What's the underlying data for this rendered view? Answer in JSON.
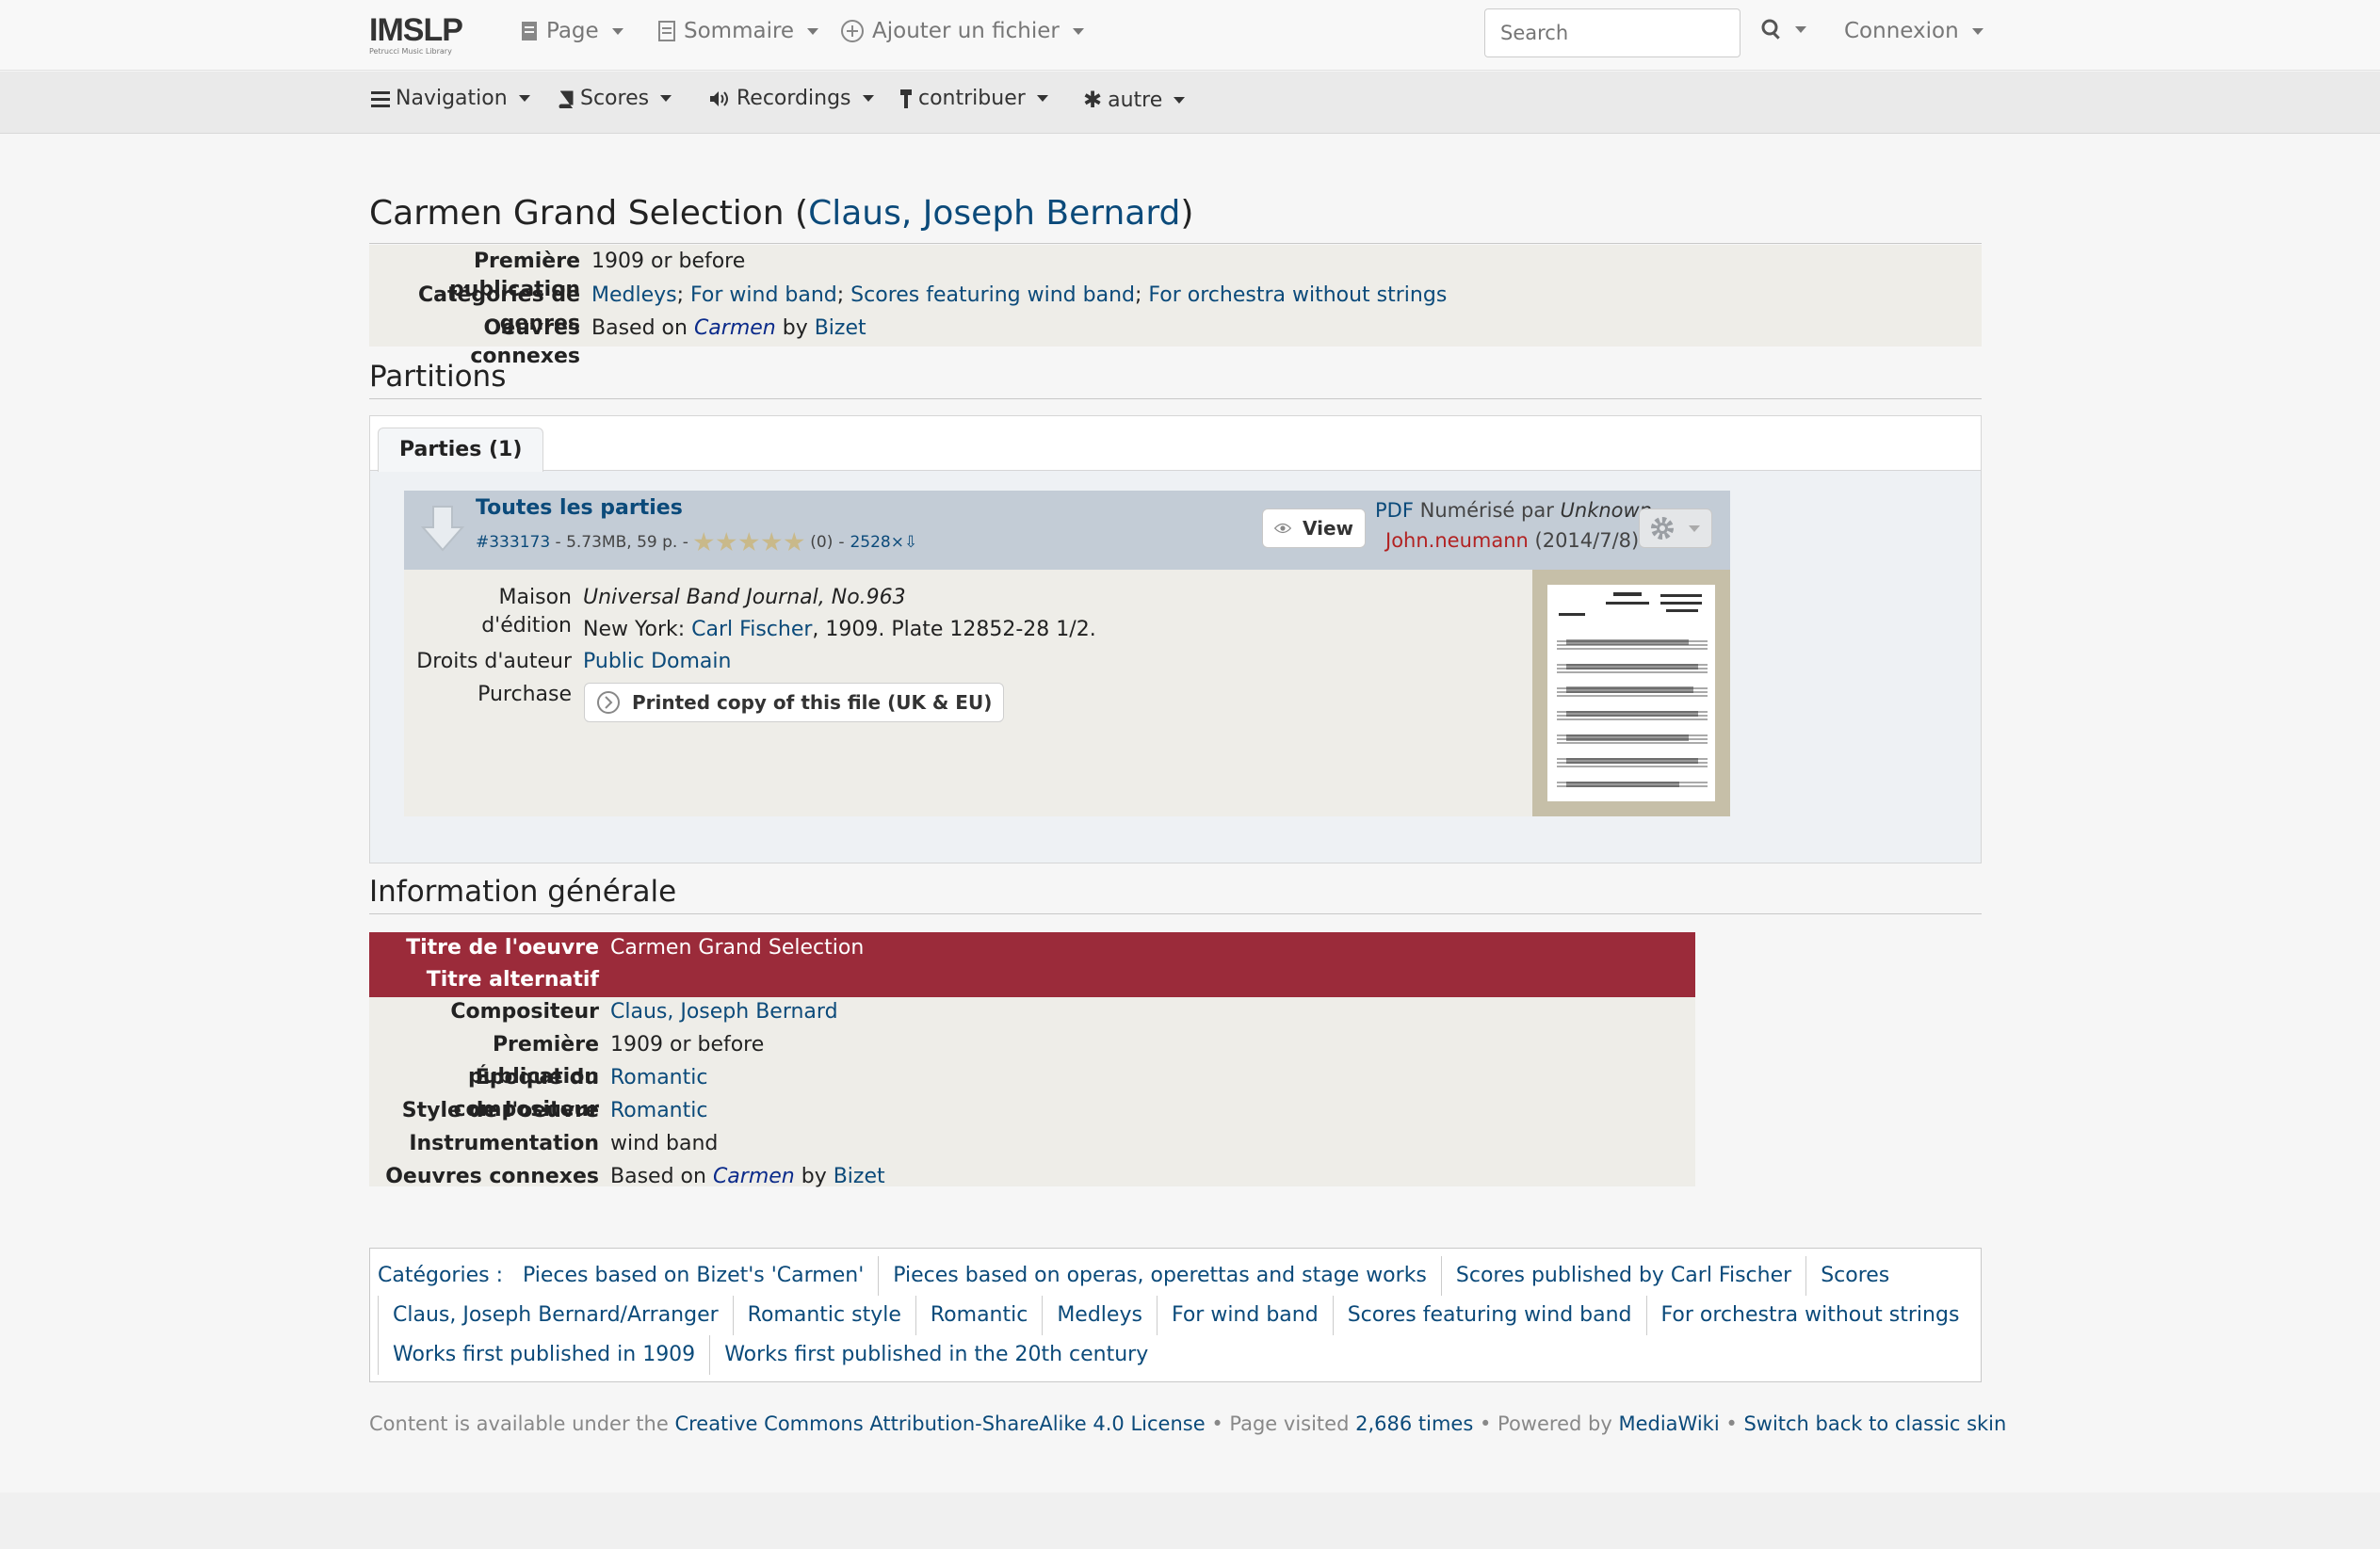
{
  "topnav": {
    "logo": "IMSLP",
    "logo_sub": "Petrucci Music Library",
    "page": "Page",
    "sommaire": "Sommaire",
    "ajouter": "Ajouter un fichier",
    "search_placeholder": "Search",
    "connexion": "Connexion"
  },
  "subnav": {
    "navigation": "Navigation",
    "scores": "Scores",
    "recordings": "Recordings",
    "contribuer": "contribuer",
    "autre": "autre"
  },
  "title": {
    "work": "Carmen Grand Selection (",
    "composer": "Claus, Joseph Bernard",
    "close": ")"
  },
  "infobox": {
    "premiere_label": "Première publication",
    "premiere_value": "1909 or before",
    "genres_label": "Catégories de genres",
    "genres": [
      "Medleys",
      "For wind band",
      "Scores featuring wind band",
      "For orchestra without strings"
    ],
    "related_label": "Oeuvres connexes",
    "related_prefix": "Based on",
    "related_work": "Carmen",
    "related_by": "by",
    "related_composer": "Bizet"
  },
  "partitions": {
    "heading": "Partitions",
    "tab_label": "Parties (1)",
    "file": {
      "title": "Toutes les parties",
      "id": "#333173",
      "meta": " - 5.73MB, 59 p. - ",
      "rating": 0,
      "rating_count": "(0)",
      "downloads": "2528×⇩",
      "view_label": "View",
      "pdf": "PDF",
      "scanned_by": "Numérisé par",
      "scanner": "Unknown",
      "uploader": "John.neumann",
      "date": "(2014/7/8)"
    },
    "edition_label": "Maison d'édition",
    "edition_line1": "Universal Band Journal, No.963",
    "edition_city": "New York:",
    "edition_publisher": "Carl Fischer",
    "edition_rest": ", 1909. Plate 12852-28 1/2.",
    "rights_label": "Droits d'auteur",
    "rights_value": "Public Domain",
    "purchase_label": "Purchase",
    "purchase_button": "Printed copy of this file (UK & EU)"
  },
  "general": {
    "heading": "Information générale",
    "rows": [
      {
        "label": "Titre de l'oeuvre",
        "value": "Carmen Grand Selection"
      },
      {
        "label": "Titre alternatif",
        "value": ""
      },
      {
        "label": "Compositeur",
        "value": "Claus, Joseph Bernard"
      },
      {
        "label": "Première publication",
        "value": "1909 or before"
      },
      {
        "label": "Époque du compositeur",
        "value": "Romantic"
      },
      {
        "label": "Style de l'oeuvre",
        "value": "Romantic"
      },
      {
        "label": "Instrumentation",
        "value": "wind band"
      },
      {
        "label": "Oeuvres connexes",
        "value_prefix": "Based on",
        "value_work": "Carmen",
        "value_by": "by",
        "value_composer": "Bizet"
      }
    ]
  },
  "categories": {
    "label": "Catégories :",
    "line1": [
      "Pieces based on Bizet's 'Carmen'",
      "Pieces based on operas, operettas and stage works",
      "Scores published by Carl Fischer",
      "Scores"
    ],
    "line2": [
      "Claus, Joseph Bernard/Arranger",
      "Romantic style",
      "Romantic",
      "Medleys",
      "For wind band",
      "Scores featuring wind band",
      "For orchestra without strings"
    ],
    "line3": [
      "Works first published in 1909",
      "Works first published in the 20th century"
    ]
  },
  "footer": {
    "prefix": "Content is available under the",
    "license": "Creative Commons Attribution-ShareAlike 4.0 License",
    "visited_prefix": "• Page visited",
    "visited": "2,686 times",
    "powered": "• Powered by",
    "mediawiki": "MediaWiki",
    "sep": "•",
    "classic": "Switch back to classic skin"
  },
  "colors": {
    "link": "#0b4a7a",
    "header_red": "#9b2b3a",
    "file_header": "#c3ccd6",
    "infobox_bg": "#eeede8",
    "user_red": "#b22222"
  }
}
